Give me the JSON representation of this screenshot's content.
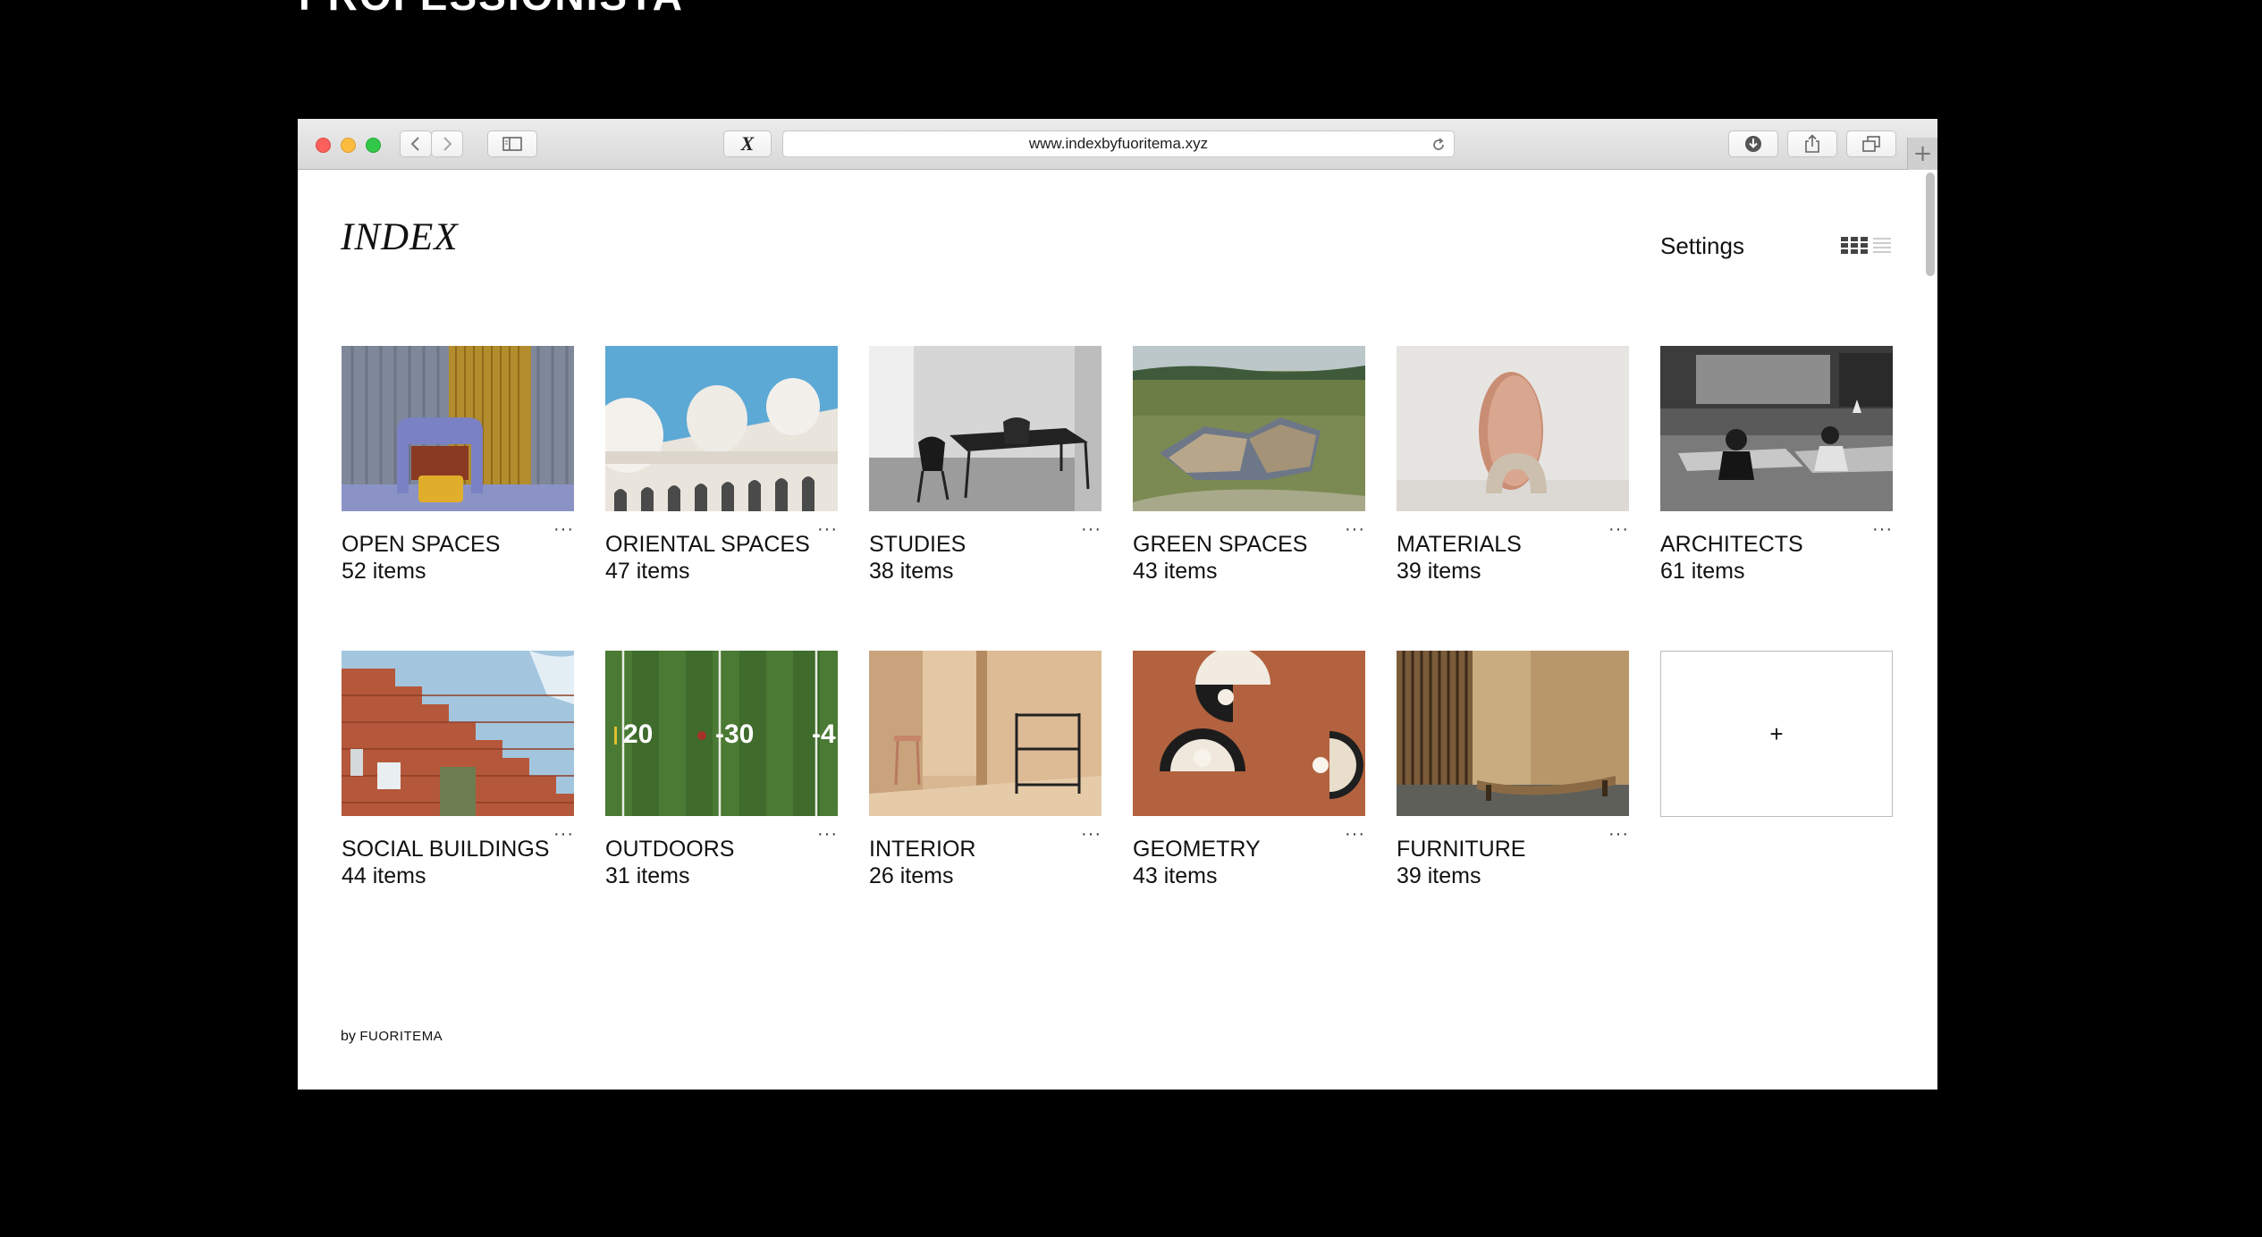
{
  "page_heading": "PROFESSIONISTA",
  "browser": {
    "url": "www.indexbyfuoritema.xyz",
    "buttons": {
      "back": "chevron-left-icon",
      "forward": "chevron-right-icon",
      "sidebar": "sidebar-icon",
      "extension": "X",
      "download": "download-icon",
      "share": "share-icon",
      "tabs": "tabs-icon",
      "new_tab": "+"
    }
  },
  "app": {
    "logo": "INDEX",
    "settings_label": "Settings",
    "view_icons": [
      "grid-view-icon",
      "list-view-icon"
    ]
  },
  "collections": [
    {
      "title": "OPEN SPACES",
      "count": "52 items",
      "more": "···"
    },
    {
      "title": "ORIENTAL SPACES",
      "count": "47 items",
      "more": "···"
    },
    {
      "title": "STUDIES",
      "count": "38 items",
      "more": "···"
    },
    {
      "title": "GREEN SPACES",
      "count": "43 items",
      "more": "···"
    },
    {
      "title": "MATERIALS",
      "count": "39 items",
      "more": "···"
    },
    {
      "title": "ARCHITECTS",
      "count": "61 items",
      "more": "···"
    },
    {
      "title": "SOCIAL BUILDINGS",
      "count": "44 items",
      "more": "···"
    },
    {
      "title": "OUTDOORS",
      "count": "31 items",
      "more": "···"
    },
    {
      "title": "INTERIOR",
      "count": "26 items",
      "more": "···"
    },
    {
      "title": "GEOMETRY",
      "count": "43 items",
      "more": "···"
    },
    {
      "title": "FURNITURE",
      "count": "39 items",
      "more": "···"
    }
  ],
  "add_collection_label": "+",
  "field_numbers": [
    "20",
    "-30",
    "-4"
  ],
  "footer": {
    "by": "by",
    "brand": "FUORITEMA"
  }
}
